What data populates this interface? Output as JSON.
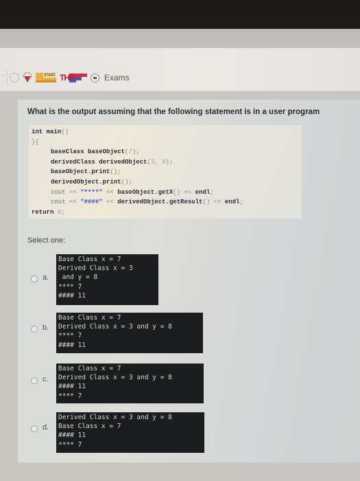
{
  "header": {
    "left_mark": "...",
    "logos": [
      "round-seal-logo",
      "shield-logo",
      "stars-logo",
      "the-rankings-logo",
      "exams-seal-logo"
    ],
    "stars_text": "STARS",
    "the_text": "THE",
    "title": "Exams"
  },
  "question": {
    "text": "What is the output assuming that the following statement is in a user program",
    "code_lines": [
      {
        "indent": false,
        "parts": [
          {
            "t": "int main",
            "c": "kw"
          },
          {
            "t": "()",
            "c": "op"
          }
        ]
      },
      {
        "indent": false,
        "parts": [
          {
            "t": "}{",
            "c": "op"
          }
        ]
      },
      {
        "indent": true,
        "parts": [
          {
            "t": "baseClass baseObject",
            "c": "kw"
          },
          {
            "t": "(",
            "c": "op"
          },
          {
            "t": "7",
            "c": "num"
          },
          {
            "t": ");",
            "c": "op"
          }
        ]
      },
      {
        "indent": true,
        "parts": [
          {
            "t": "derivedClass derivedObject",
            "c": "kw"
          },
          {
            "t": "(",
            "c": "op"
          },
          {
            "t": "3",
            "c": "num"
          },
          {
            "t": ", ",
            "c": "op"
          },
          {
            "t": "8",
            "c": "num"
          },
          {
            "t": ");",
            "c": "op"
          }
        ]
      },
      {
        "indent": true,
        "parts": [
          {
            "t": "baseObject.print",
            "c": "kw"
          },
          {
            "t": "();",
            "c": "op"
          }
        ]
      },
      {
        "indent": true,
        "parts": [
          {
            "t": "derivedObject.print",
            "c": "kw"
          },
          {
            "t": "();",
            "c": "op"
          }
        ]
      },
      {
        "indent": true,
        "parts": [
          {
            "t": "cout",
            "c": "cout"
          },
          {
            "t": " << ",
            "c": "op"
          },
          {
            "t": "\"****\"",
            "c": "str"
          },
          {
            "t": " << ",
            "c": "op"
          },
          {
            "t": "baseObject.getX",
            "c": "kw"
          },
          {
            "t": "()",
            "c": "op"
          },
          {
            "t": " << ",
            "c": "op"
          },
          {
            "t": "endl",
            "c": "kw"
          },
          {
            "t": ";",
            "c": "op"
          }
        ]
      },
      {
        "indent": true,
        "parts": [
          {
            "t": "cout",
            "c": "cout"
          },
          {
            "t": " << ",
            "c": "op"
          },
          {
            "t": "\"####\"",
            "c": "str"
          },
          {
            "t": " << ",
            "c": "op"
          },
          {
            "t": "derivedObject.getResult",
            "c": "kw"
          },
          {
            "t": "()",
            "c": "op"
          },
          {
            "t": " << ",
            "c": "op"
          },
          {
            "t": "endl",
            "c": "kw"
          },
          {
            "t": ";",
            "c": "op"
          }
        ]
      },
      {
        "indent": false,
        "parts": [
          {
            "t": "return ",
            "c": "kw"
          },
          {
            "t": "0",
            "c": "num"
          },
          {
            "t": ";",
            "c": "op"
          }
        ]
      }
    ],
    "select_label": "Select one:",
    "options": [
      {
        "letter": "a.",
        "selected": false,
        "lines": [
          "Base Class x = 7",
          "Derived Class x = 3",
          " and y = 8",
          "**** 7",
          "#### 11"
        ]
      },
      {
        "letter": "b.",
        "selected": false,
        "lines": [
          "Base Class x = 7",
          "Derived Class x = 3 and y = 8",
          "**** 7",
          "#### 11"
        ]
      },
      {
        "letter": "c.",
        "selected": false,
        "lines": [
          "Base Class x = 7",
          "Derived Class x = 3 and y = 8",
          "#### 11",
          "**** 7"
        ]
      },
      {
        "letter": "d.",
        "selected": false,
        "lines": [
          "Derived Class x = 3 and y = 8",
          "Base Class x = 7",
          "#### 11",
          "**** 7"
        ]
      }
    ]
  }
}
